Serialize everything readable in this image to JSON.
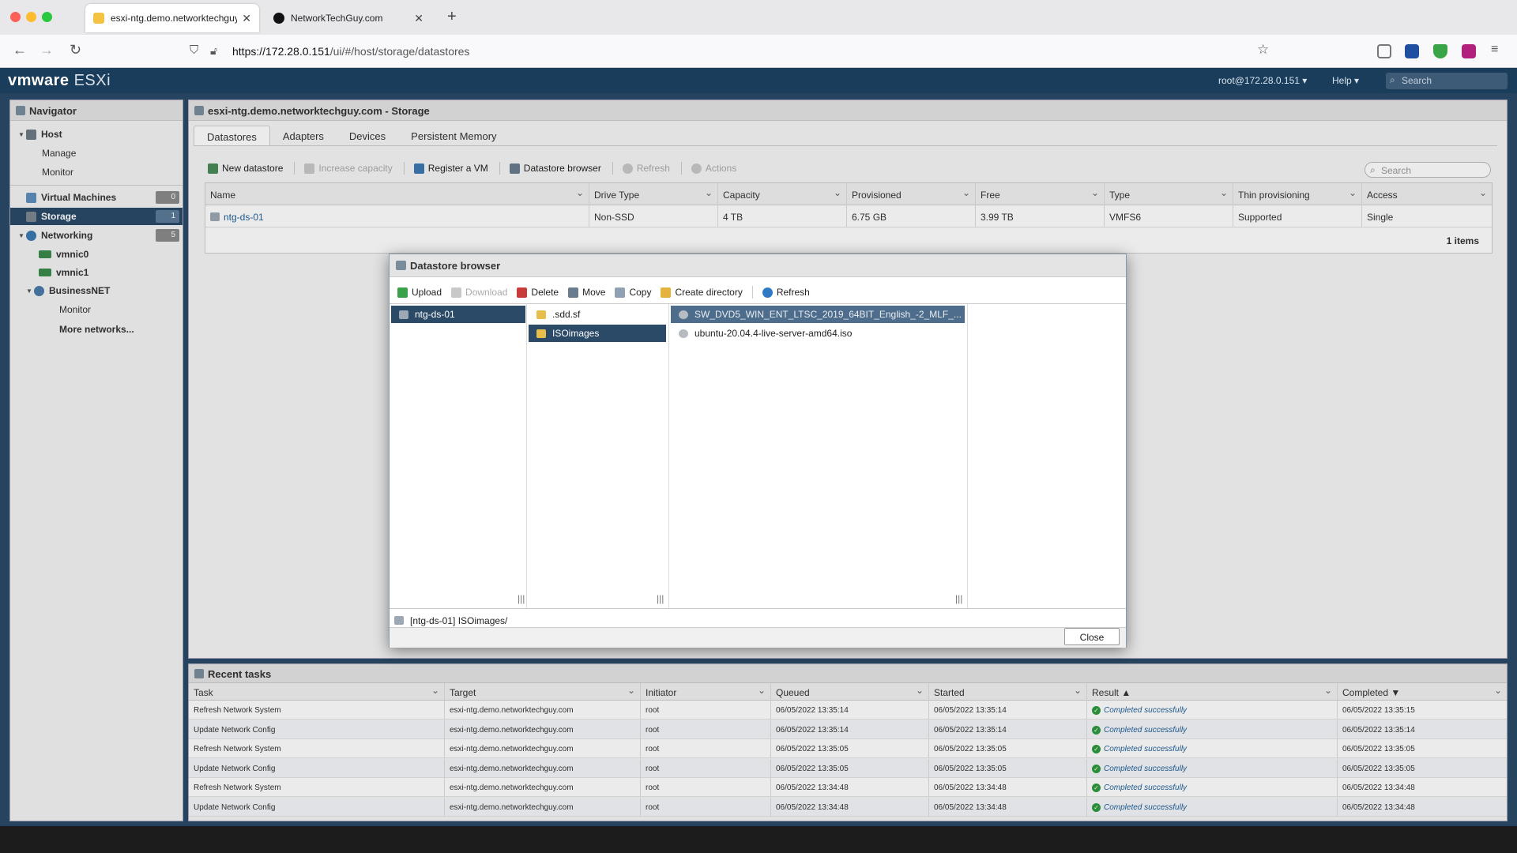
{
  "browser": {
    "tabs": [
      {
        "label": "esxi-ntg.demo.networktechguy.com",
        "active": true
      },
      {
        "label": "NetworkTechGuy.com",
        "active": false
      }
    ],
    "url_host": "https://172.28.0.151",
    "url_path": "/ui/#/host/storage/datastores"
  },
  "esxi_header": {
    "logo_vm": "vmware",
    "logo_product": "ESXi",
    "user": "root@172.28.0.151 ▾",
    "help": "Help ▾",
    "search_placeholder": "Search"
  },
  "navigator": {
    "title": "Navigator",
    "host": "Host",
    "manage": "Manage",
    "monitor": "Monitor",
    "virtual_machines": {
      "label": "Virtual Machines",
      "count": "0"
    },
    "storage": {
      "label": "Storage",
      "count": "1"
    },
    "networking": {
      "label": "Networking",
      "count": "5"
    },
    "vmnic0": "vmnic0",
    "vmnic1": "vmnic1",
    "businessnet": "BusinessNET",
    "bn_monitor": "Monitor",
    "more_networks": "More networks..."
  },
  "storage_panel": {
    "title": "esxi-ntg.demo.networktechguy.com - Storage",
    "tabs": [
      "Datastores",
      "Adapters",
      "Devices",
      "Persistent Memory"
    ],
    "toolbar": {
      "new_datastore": "New datastore",
      "increase_capacity": "Increase capacity",
      "register_vm": "Register a VM",
      "datastore_browser": "Datastore browser",
      "refresh": "Refresh",
      "actions": "Actions"
    },
    "search_placeholder": "Search",
    "columns": [
      "Name",
      "Drive Type",
      "Capacity",
      "Provisioned",
      "Free",
      "Type",
      "Thin provisioning",
      "Access"
    ],
    "rows": [
      [
        "ntg-ds-01",
        "Non-SSD",
        "4 TB",
        "6.75 GB",
        "3.99 TB",
        "VMFS6",
        "Supported",
        "Single"
      ]
    ],
    "items_count": "1 items"
  },
  "recent_tasks": {
    "title": "Recent tasks",
    "columns": [
      "Task",
      "Target",
      "Initiator",
      "Queued",
      "Started",
      "Result ▲",
      "Completed ▼"
    ],
    "rows": [
      [
        "Refresh Network System",
        "esxi-ntg.demo.networktechguy.com",
        "root",
        "06/05/2022 13:35:14",
        "06/05/2022 13:35:14",
        "Completed successfully",
        "06/05/2022 13:35:15"
      ],
      [
        "Update Network Config",
        "esxi-ntg.demo.networktechguy.com",
        "root",
        "06/05/2022 13:35:14",
        "06/05/2022 13:35:14",
        "Completed successfully",
        "06/05/2022 13:35:14"
      ],
      [
        "Refresh Network System",
        "esxi-ntg.demo.networktechguy.com",
        "root",
        "06/05/2022 13:35:05",
        "06/05/2022 13:35:05",
        "Completed successfully",
        "06/05/2022 13:35:05"
      ],
      [
        "Update Network Config",
        "esxi-ntg.demo.networktechguy.com",
        "root",
        "06/05/2022 13:35:05",
        "06/05/2022 13:35:05",
        "Completed successfully",
        "06/05/2022 13:35:05"
      ],
      [
        "Refresh Network System",
        "esxi-ntg.demo.networktechguy.com",
        "root",
        "06/05/2022 13:34:48",
        "06/05/2022 13:34:48",
        "Completed successfully",
        "06/05/2022 13:34:48"
      ],
      [
        "Update Network Config",
        "esxi-ntg.demo.networktechguy.com",
        "root",
        "06/05/2022 13:34:48",
        "06/05/2022 13:34:48",
        "Completed successfully",
        "06/05/2022 13:34:48"
      ]
    ]
  },
  "datastore_browser": {
    "title": "Datastore browser",
    "toolbar": {
      "upload": "Upload",
      "download": "Download",
      "delete": "Delete",
      "move": "Move",
      "copy": "Copy",
      "create_directory": "Create directory",
      "refresh": "Refresh"
    },
    "col1": [
      "ntg-ds-01"
    ],
    "col2": [
      ".sdd.sf",
      "ISOimages"
    ],
    "col3": [
      "SW_DVD5_WIN_ENT_LTSC_2019_64BIT_English_-2_MLF_...",
      "ubuntu-20.04.4-live-server-amd64.iso"
    ],
    "path": "[ntg-ds-01] ISOimages/",
    "close": "Close"
  },
  "colors": {
    "esxi_header": "#1a3d5c",
    "selection": "#2a4a68",
    "link": "#1f5f99",
    "success": "#2e9a3e"
  }
}
